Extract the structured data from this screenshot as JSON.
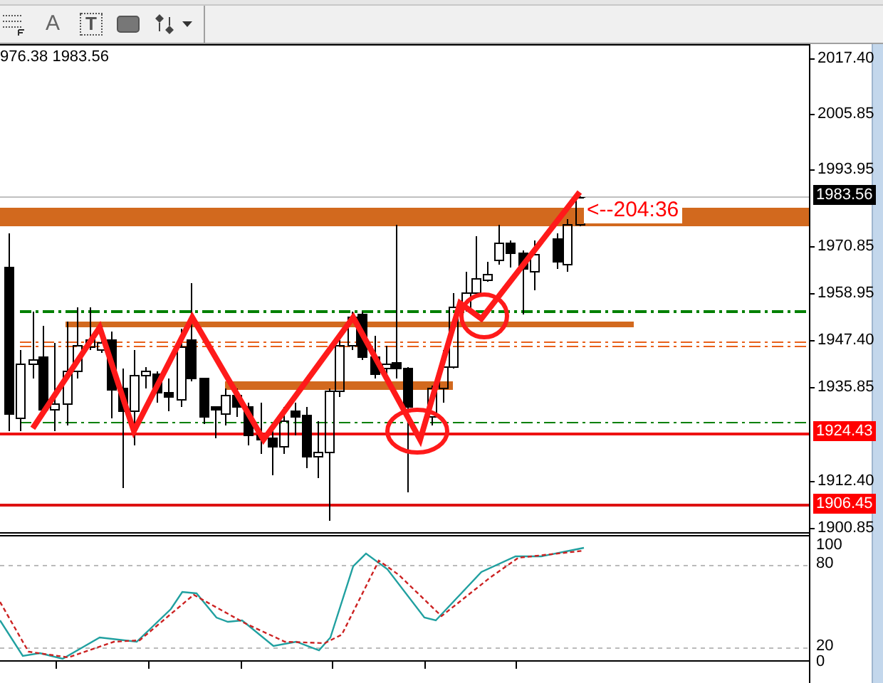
{
  "toolbar": {
    "text_tool": "A",
    "label_tool": "T"
  },
  "chart": {
    "header": "976.38 1983.56",
    "annotation": "<--204:36",
    "price_axis": [
      {
        "label": "2017.40",
        "kind": "tick"
      },
      {
        "label": "2005.85",
        "kind": "tick"
      },
      {
        "label": "1993.95",
        "kind": "tick"
      },
      {
        "label": "1983.56",
        "kind": "current"
      },
      {
        "label": "1970.85",
        "kind": "tick"
      },
      {
        "label": "1958.95",
        "kind": "tick"
      },
      {
        "label": "1947.40",
        "kind": "tick"
      },
      {
        "label": "1935.85",
        "kind": "tick"
      },
      {
        "label": "1924.43",
        "kind": "line"
      },
      {
        "label": "1912.40",
        "kind": "tick"
      },
      {
        "label": "1906.45",
        "kind": "line"
      },
      {
        "label": "1900.85",
        "kind": "tick"
      }
    ]
  },
  "oscillator": {
    "axis": [
      "100",
      "80",
      "20",
      "0"
    ]
  }
}
